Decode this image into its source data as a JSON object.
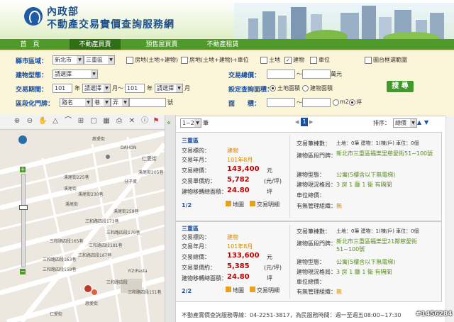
{
  "header": {
    "org": "內政部",
    "site": "不動產交易實價查詢服務網"
  },
  "nav": {
    "tabs": [
      "首　頁",
      "不動產買賣",
      "預售屋買賣",
      "不動產租賃"
    ]
  },
  "search": {
    "county_label": "縣市區域：",
    "county_value": "新北市",
    "district_value": "三重區",
    "types": [
      "房地(土地+建物)",
      "房地(土地+建物)+車位",
      "土地",
      "建物",
      "車位"
    ],
    "types_checked": [
      false,
      false,
      false,
      true,
      false
    ],
    "map_range_label": "圖台框選範圍",
    "building_type_label": "建物型態：",
    "building_type_value": "請選擇",
    "total_price_label": "交易總價：",
    "total_price_unit": "萬元",
    "range_sep": "～",
    "period_label": "交易期間：",
    "period_from_year": "101",
    "year_label": "年",
    "period_from_month": "請選擇",
    "month_label": "月～",
    "period_to_year": "101",
    "period_to_month": "請選擇",
    "month_end": "月",
    "area_setting_label": "設定查詢面積：",
    "area_options": [
      "土地面積",
      "建物面積"
    ],
    "search_button": "搜 尋",
    "address_label": "區段化門牌：",
    "road_value": "路名",
    "lane_value": "巷",
    "alley_value": "弄",
    "no_suffix": "號",
    "area_label": "面　　積：",
    "area_units": [
      "m2",
      "坪"
    ]
  },
  "results": {
    "page_select": "1~2",
    "page_unit": "筆",
    "page_num": "1",
    "sort_label": "排序：",
    "sort_value": "總價",
    "items": [
      {
        "district": "三重區",
        "type_label": "交易標的：",
        "type": "建物",
        "date_label": "交易年月：",
        "date": "101年8月",
        "total_label": "交易總價：",
        "total": "143,400",
        "total_unit": "元",
        "unit_label": "交易單價約：",
        "unit": "5,782",
        "unit_unit": "(元/坪)",
        "area_label": "建物移轉總面積：",
        "area": "24.80",
        "area_unit": "坪",
        "index": "1/2",
        "map_btn": "地圖",
        "detail_btn": "交易明細",
        "count_label": "交易筆棟數：",
        "count": "土地：0筆 建物：1(棟/戶) 車位：0個",
        "addr_label": "建物區段門牌：",
        "addr": "新北市三重區福樂里慈愛街51~100號",
        "btype_label": "建物型態：",
        "btype": "公寓(5樓含以下無電梯)",
        "layout_label": "建物現況格局：",
        "layout": "3 房 1 廳 1 衛 有隔間",
        "parking_label": "車位總價：",
        "parking": "",
        "mgmt_label": "有無管理組織：",
        "mgmt": "無"
      },
      {
        "district": "三重區",
        "type_label": "交易標的：",
        "type": "建物",
        "date_label": "交易年月：",
        "date": "101年8月",
        "total_label": "交易總價：",
        "total": "133,600",
        "total_unit": "元",
        "unit_label": "交易單價約：",
        "unit": "5,385",
        "unit_unit": "(元/坪)",
        "area_label": "建物移轉總面積：",
        "area": "24.80",
        "area_unit": "坪",
        "index": "2/2",
        "map_btn": "地圖",
        "detail_btn": "交易明細",
        "count_label": "交易筆棟數：",
        "count": "土地：0筆 建物：1(棟/戶) 車位：0個",
        "addr_label": "建物區段門牌：",
        "addr": "新北市三重區福樂里21鄰慈愛街51~100號",
        "btype_label": "建物型態：",
        "btype": "公寓(5樓含以下無電梯)",
        "layout_label": "建物現況格局：",
        "layout": "3 房 1 廳 1 衛 有隔間",
        "parking_label": "車位總價：",
        "parking": "",
        "mgmt_label": "有無管理組織：",
        "mgmt": "無"
      }
    ]
  },
  "map": {
    "labels": [
      "慈愛街",
      "DAHON",
      "仁愛街",
      "溪尾街205巷",
      "溪尾街225巷",
      "溪尾街230巷",
      "溪尾街",
      "溪尾街",
      "三和路四段173巷",
      "三和路四段179巷",
      "三和路四段181巷",
      "三和路四段167巷",
      "三和路四段163巷",
      "溪尾街259巷",
      "三和路四段165巷",
      "三和路四段159巷",
      "YIZIPasta",
      "三和路四段",
      "三和路四段151巷",
      "慈愛街",
      "仁愛街",
      "分子蛋"
    ]
  },
  "footer": "不動產實價查詢服務專線：04-2251-3817，為民服務時間：週一至週五08:00~17:30",
  "watermark": "#1456284",
  "colors": {
    "nav": "#4f9a2b",
    "label_blue": "#1b4fa0",
    "price_red": "#c00000"
  }
}
